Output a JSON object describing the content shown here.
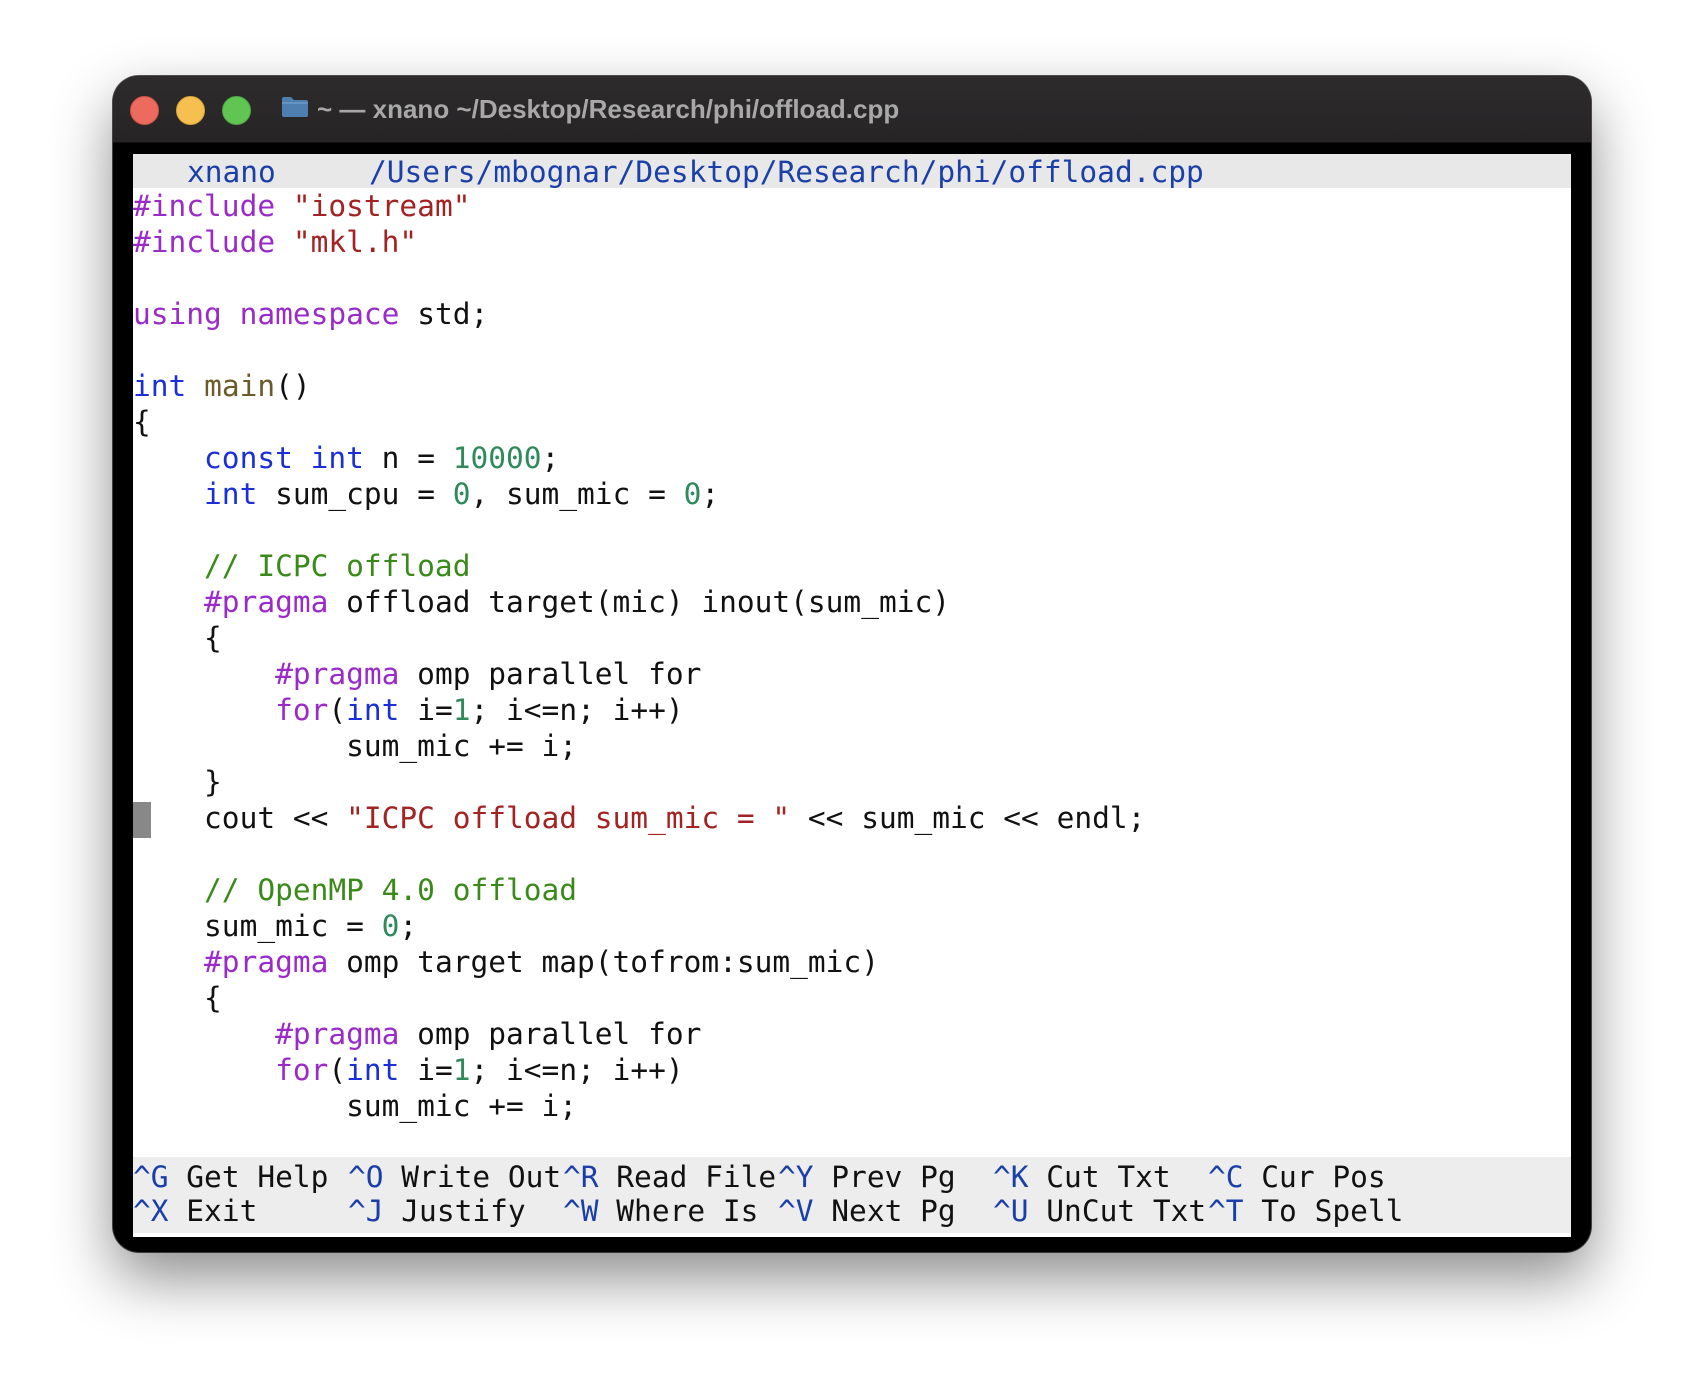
{
  "window": {
    "title": "~ — xnano ~/Desktop/Research/phi/offload.cpp"
  },
  "header": {
    "program": "xnano",
    "path": "/Users/mbognar/Desktop/Research/phi/offload.cpp"
  },
  "code_lines": [
    [
      {
        "t": "#include ",
        "c": "pp"
      },
      {
        "t": "\"iostream\"",
        "c": "str"
      }
    ],
    [
      {
        "t": "#include ",
        "c": "pp"
      },
      {
        "t": "\"mkl.h\"",
        "c": "str"
      }
    ],
    [],
    [
      {
        "t": "using",
        "c": "kw"
      },
      {
        "t": " ",
        "c": "plain"
      },
      {
        "t": "namespace",
        "c": "kw"
      },
      {
        "t": " std;",
        "c": "plain"
      }
    ],
    [],
    [
      {
        "t": "int",
        "c": "type"
      },
      {
        "t": " ",
        "c": "plain"
      },
      {
        "t": "main",
        "c": "fn"
      },
      {
        "t": "()",
        "c": "plain"
      }
    ],
    [
      {
        "t": "{",
        "c": "plain"
      }
    ],
    [
      {
        "t": "    ",
        "c": "plain"
      },
      {
        "t": "const",
        "c": "type"
      },
      {
        "t": " ",
        "c": "plain"
      },
      {
        "t": "int",
        "c": "type"
      },
      {
        "t": " n = ",
        "c": "plain"
      },
      {
        "t": "10000",
        "c": "num"
      },
      {
        "t": ";",
        "c": "plain"
      }
    ],
    [
      {
        "t": "    ",
        "c": "plain"
      },
      {
        "t": "int",
        "c": "type"
      },
      {
        "t": " sum_cpu = ",
        "c": "plain"
      },
      {
        "t": "0",
        "c": "num"
      },
      {
        "t": ", sum_mic = ",
        "c": "plain"
      },
      {
        "t": "0",
        "c": "num"
      },
      {
        "t": ";",
        "c": "plain"
      }
    ],
    [],
    [
      {
        "t": "    ",
        "c": "plain"
      },
      {
        "t": "// ICPC offload",
        "c": "cmt"
      }
    ],
    [
      {
        "t": "    ",
        "c": "plain"
      },
      {
        "t": "#pragma",
        "c": "pp"
      },
      {
        "t": " offload target(mic) inout(sum_mic)",
        "c": "plain"
      }
    ],
    [
      {
        "t": "    {",
        "c": "plain"
      }
    ],
    [
      {
        "t": "        ",
        "c": "plain"
      },
      {
        "t": "#pragma",
        "c": "pp"
      },
      {
        "t": " omp parallel for",
        "c": "plain"
      }
    ],
    [
      {
        "t": "        ",
        "c": "plain"
      },
      {
        "t": "for",
        "c": "kw"
      },
      {
        "t": "(",
        "c": "plain"
      },
      {
        "t": "int",
        "c": "type"
      },
      {
        "t": " i=",
        "c": "plain"
      },
      {
        "t": "1",
        "c": "num"
      },
      {
        "t": "; i<=n; i++)",
        "c": "plain"
      }
    ],
    [
      {
        "t": "            sum_mic += i;",
        "c": "plain"
      }
    ],
    [
      {
        "t": "    }",
        "c": "plain"
      }
    ],
    [
      {
        "t": "    cout << ",
        "c": "plain"
      },
      {
        "t": "\"ICPC offload sum_mic = \"",
        "c": "str"
      },
      {
        "t": " << sum_mic << endl;",
        "c": "plain"
      }
    ],
    [],
    [
      {
        "t": "    ",
        "c": "plain"
      },
      {
        "t": "// OpenMP 4.0 offload",
        "c": "cmt"
      }
    ],
    [
      {
        "t": "    sum_mic = ",
        "c": "plain"
      },
      {
        "t": "0",
        "c": "num"
      },
      {
        "t": ";",
        "c": "plain"
      }
    ],
    [
      {
        "t": "    ",
        "c": "plain"
      },
      {
        "t": "#pragma",
        "c": "pp"
      },
      {
        "t": " omp target map(tofrom:sum_mic)",
        "c": "plain"
      }
    ],
    [
      {
        "t": "    {",
        "c": "plain"
      }
    ],
    [
      {
        "t": "        ",
        "c": "plain"
      },
      {
        "t": "#pragma",
        "c": "pp"
      },
      {
        "t": " omp parallel for",
        "c": "plain"
      }
    ],
    [
      {
        "t": "        ",
        "c": "plain"
      },
      {
        "t": "for",
        "c": "kw"
      },
      {
        "t": "(",
        "c": "plain"
      },
      {
        "t": "int",
        "c": "type"
      },
      {
        "t": " i=",
        "c": "plain"
      },
      {
        "t": "1",
        "c": "num"
      },
      {
        "t": "; i<=n; i++)",
        "c": "plain"
      }
    ],
    [
      {
        "t": "            sum_mic += i;",
        "c": "plain"
      }
    ]
  ],
  "shortcuts": [
    [
      {
        "key": "^G",
        "label": "Get Help"
      },
      {
        "key": "^O",
        "label": "Write Out"
      },
      {
        "key": "^R",
        "label": "Read File"
      },
      {
        "key": "^Y",
        "label": "Prev Pg"
      },
      {
        "key": "^K",
        "label": "Cut Txt"
      },
      {
        "key": "^C",
        "label": "Cur Pos"
      }
    ],
    [
      {
        "key": "^X",
        "label": "Exit"
      },
      {
        "key": "^J",
        "label": "Justify"
      },
      {
        "key": "^W",
        "label": "Where Is"
      },
      {
        "key": "^V",
        "label": "Next Pg"
      },
      {
        "key": "^U",
        "label": "UnCut Txt"
      },
      {
        "key": "^T",
        "label": "To Spell"
      }
    ]
  ],
  "colors": {
    "preprocessor": "#9a2bc8",
    "string": "#a32222",
    "type": "#1a2fd8",
    "number": "#2e8a5a",
    "comment": "#3a8a1a",
    "shortcut_key": "#1a3fa8"
  }
}
